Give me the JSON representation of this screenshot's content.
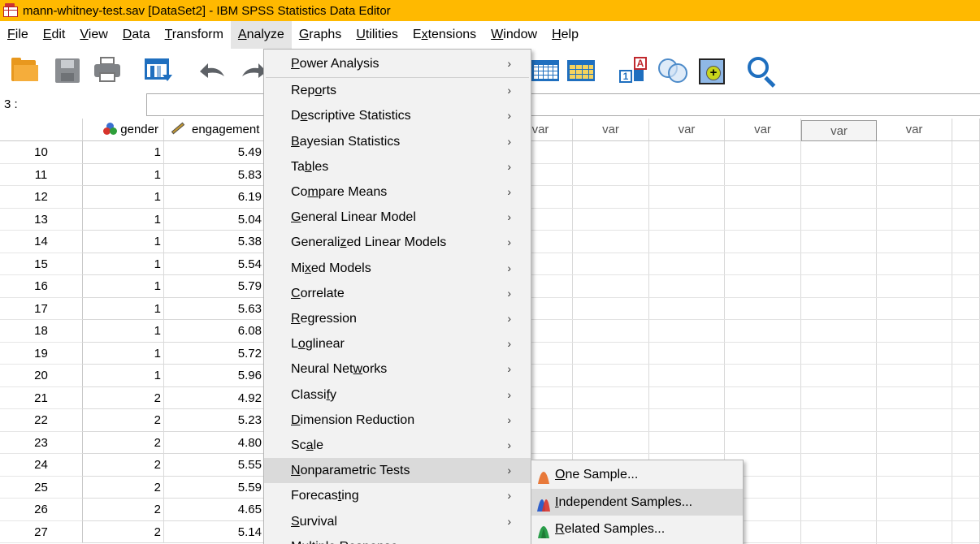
{
  "window": {
    "title": "mann-whitney-test.sav [DataSet2] - IBM SPSS Statistics Data Editor",
    "accent_color": "#ffb900"
  },
  "menubar": {
    "items": [
      {
        "pre": "",
        "key": "F",
        "post": "ile"
      },
      {
        "pre": "",
        "key": "E",
        "post": "dit"
      },
      {
        "pre": "",
        "key": "V",
        "post": "iew"
      },
      {
        "pre": "",
        "key": "D",
        "post": "ata"
      },
      {
        "pre": "",
        "key": "T",
        "post": "ransform"
      },
      {
        "pre": "",
        "key": "A",
        "post": "nalyze"
      },
      {
        "pre": "",
        "key": "G",
        "post": "raphs"
      },
      {
        "pre": "",
        "key": "U",
        "post": "tilities"
      },
      {
        "pre": "E",
        "key": "x",
        "post": "tensions"
      },
      {
        "pre": "",
        "key": "W",
        "post": "indow"
      },
      {
        "pre": "",
        "key": "H",
        "post": "elp"
      }
    ],
    "active_index": 5
  },
  "toolbar": {
    "icons": [
      "open-folder-icon",
      "save-icon",
      "print-icon",
      "recall-dialog-icon",
      "undo-icon",
      "redo-icon",
      "goto-case-icon",
      "goto-variable-icon",
      "value-labels-icon",
      "use-variable-sets-icon",
      "add-variable-icon",
      "find-icon"
    ]
  },
  "cellbar": {
    "reference": "3 :",
    "value": ""
  },
  "grid": {
    "columns": {
      "gender": "gender",
      "engagement": "engagement",
      "var_label": "var"
    },
    "rows": [
      {
        "n": "10",
        "gender": "1",
        "engagement": "5.49"
      },
      {
        "n": "11",
        "gender": "1",
        "engagement": "5.83"
      },
      {
        "n": "12",
        "gender": "1",
        "engagement": "6.19"
      },
      {
        "n": "13",
        "gender": "1",
        "engagement": "5.04"
      },
      {
        "n": "14",
        "gender": "1",
        "engagement": "5.38"
      },
      {
        "n": "15",
        "gender": "1",
        "engagement": "5.54"
      },
      {
        "n": "16",
        "gender": "1",
        "engagement": "5.79"
      },
      {
        "n": "17",
        "gender": "1",
        "engagement": "5.63"
      },
      {
        "n": "18",
        "gender": "1",
        "engagement": "6.08"
      },
      {
        "n": "19",
        "gender": "1",
        "engagement": "5.72"
      },
      {
        "n": "20",
        "gender": "1",
        "engagement": "5.96"
      },
      {
        "n": "21",
        "gender": "2",
        "engagement": "4.92"
      },
      {
        "n": "22",
        "gender": "2",
        "engagement": "5.23"
      },
      {
        "n": "23",
        "gender": "2",
        "engagement": "4.80"
      },
      {
        "n": "24",
        "gender": "2",
        "engagement": "5.55"
      },
      {
        "n": "25",
        "gender": "2",
        "engagement": "5.59"
      },
      {
        "n": "26",
        "gender": "2",
        "engagement": "4.65"
      },
      {
        "n": "27",
        "gender": "2",
        "engagement": "5.14"
      }
    ]
  },
  "analyze_menu": {
    "items": [
      {
        "pre": "",
        "key": "P",
        "post": "ower Analysis"
      },
      {
        "pre": "Rep",
        "key": "o",
        "post": "rts"
      },
      {
        "pre": "D",
        "key": "e",
        "post": "scriptive Statistics"
      },
      {
        "pre": "",
        "key": "B",
        "post": "ayesian Statistics"
      },
      {
        "pre": "Ta",
        "key": "b",
        "post": "les"
      },
      {
        "pre": "Co",
        "key": "m",
        "post": "pare Means"
      },
      {
        "pre": "",
        "key": "G",
        "post": "eneral Linear Model"
      },
      {
        "pre": "Generali",
        "key": "z",
        "post": "ed Linear Models"
      },
      {
        "pre": "Mi",
        "key": "x",
        "post": "ed Models"
      },
      {
        "pre": "",
        "key": "C",
        "post": "orrelate"
      },
      {
        "pre": "",
        "key": "R",
        "post": "egression"
      },
      {
        "pre": "L",
        "key": "o",
        "post": "glinear"
      },
      {
        "pre": "Neural Net",
        "key": "w",
        "post": "orks"
      },
      {
        "pre": "Classi",
        "key": "f",
        "post": "y"
      },
      {
        "pre": "",
        "key": "D",
        "post": "imension Reduction"
      },
      {
        "pre": "Sc",
        "key": "a",
        "post": "le"
      },
      {
        "pre": "",
        "key": "N",
        "post": "onparametric Tests"
      },
      {
        "pre": "Forecas",
        "key": "t",
        "post": "ing"
      },
      {
        "pre": "",
        "key": "S",
        "post": "urvival"
      },
      {
        "pre": "M",
        "key": "u",
        "post": "ltiple Response"
      }
    ],
    "highlighted_index": 16,
    "submenu_glyph": "›"
  },
  "nonparametric_submenu": {
    "items": [
      {
        "pre": "",
        "key": "O",
        "post": "ne Sample...",
        "icon": "one-sample-icon",
        "color": "#e8793a"
      },
      {
        "pre": "",
        "key": "I",
        "post": "ndependent Samples...",
        "icon": "independent-samples-icon",
        "color": "#2f5fc9"
      },
      {
        "pre": "",
        "key": "R",
        "post": "elated Samples...",
        "icon": "related-samples-icon",
        "color": "#2a9d4a"
      }
    ],
    "highlighted_index": 1
  }
}
